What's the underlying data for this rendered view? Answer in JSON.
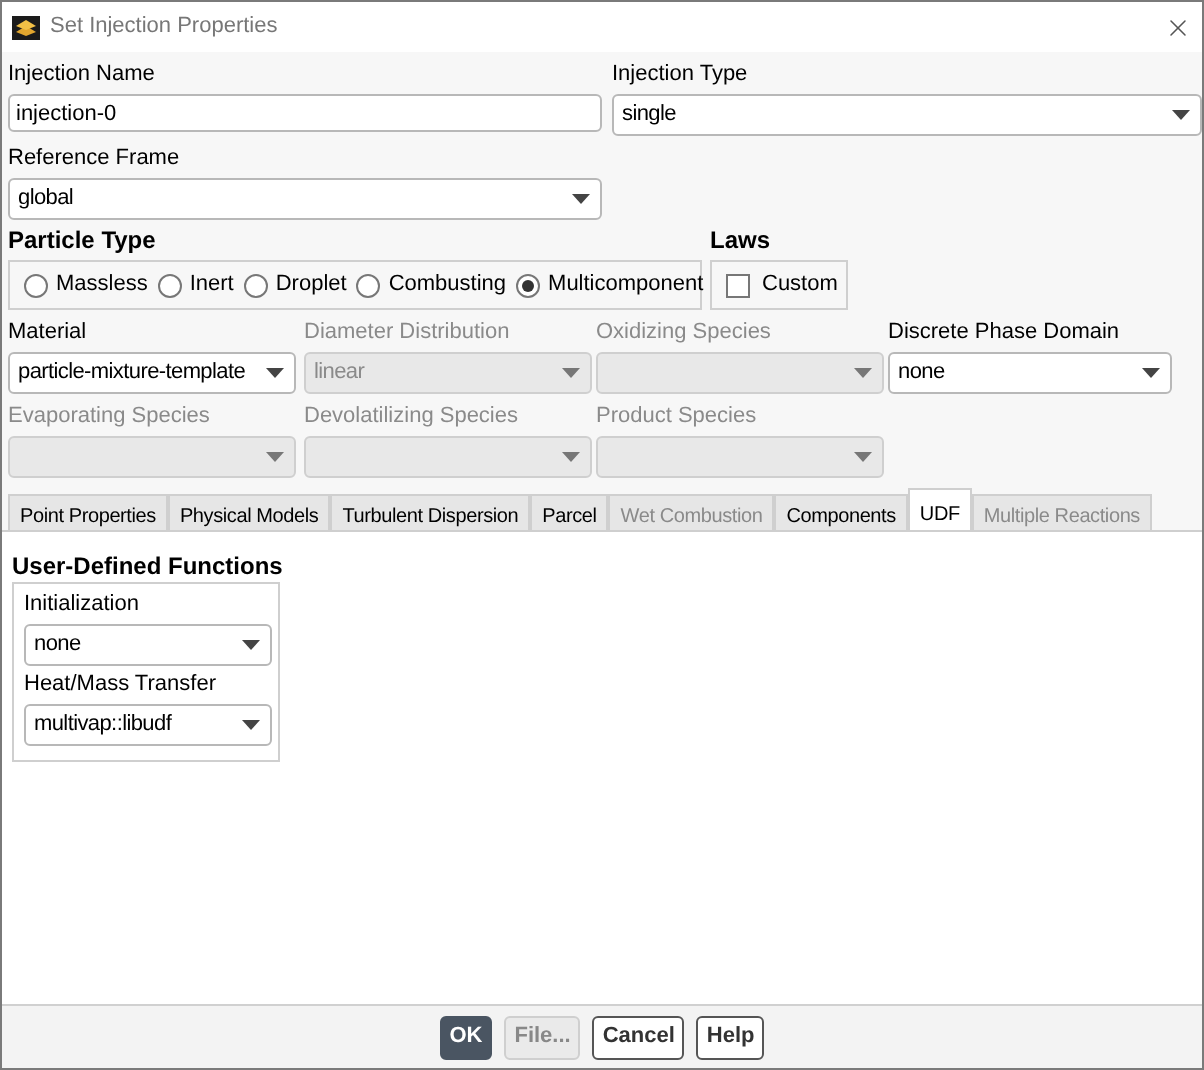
{
  "window": {
    "title": "Set Injection Properties"
  },
  "top_fields": [
    {
      "label": "Injection Name",
      "kind": "text",
      "value": "injection-0"
    },
    {
      "label": "Injection Type",
      "kind": "dropdown",
      "value": "single"
    },
    {
      "label": "Reference Frame",
      "kind": "dropdown",
      "value": "global"
    }
  ],
  "particle_type": {
    "label": "Particle Type",
    "options": [
      {
        "label": "Massless",
        "selected": false
      },
      {
        "label": "Inert",
        "selected": false
      },
      {
        "label": "Droplet",
        "selected": false
      },
      {
        "label": "Combusting",
        "selected": false
      },
      {
        "label": "Multicomponent",
        "selected": true
      }
    ]
  },
  "laws": {
    "label": "Laws",
    "options": [
      {
        "label": "Custom",
        "checked": false
      }
    ]
  },
  "species_fields": [
    {
      "label": "Material",
      "value": "particle-mixture-template",
      "disabled": false
    },
    {
      "label": "Diameter Distribution",
      "value": "linear",
      "disabled": true
    },
    {
      "label": "Oxidizing Species",
      "disabled": true
    },
    {
      "label": "Discrete Phase Domain",
      "value": "none",
      "disabled": false
    },
    {
      "label": "Evaporating Species",
      "disabled": true
    },
    {
      "label": "Devolatilizing Species",
      "disabled": true
    },
    {
      "label": "Product Species",
      "disabled": true
    }
  ],
  "tabs": [
    {
      "label": "Point Properties",
      "selected": false,
      "disabled": false
    },
    {
      "label": "Physical Models",
      "selected": false,
      "disabled": false
    },
    {
      "label": "Turbulent Dispersion",
      "selected": false,
      "disabled": false
    },
    {
      "label": "Parcel",
      "selected": false,
      "disabled": false
    },
    {
      "label": "Wet Combustion",
      "selected": false,
      "disabled": true
    },
    {
      "label": "Components",
      "selected": false,
      "disabled": false
    },
    {
      "label": "UDF",
      "selected": true,
      "disabled": false
    },
    {
      "label": "Multiple Reactions",
      "selected": false,
      "disabled": true
    }
  ],
  "udf": {
    "title": "User-Defined Functions",
    "fields": [
      {
        "label": "Initialization",
        "value": "none"
      },
      {
        "label": "Heat/Mass Transfer",
        "value": "multivap::libudf"
      }
    ]
  },
  "buttons": [
    {
      "label": "OK",
      "kind": "primary"
    },
    {
      "label": "File...",
      "kind": "disabled"
    },
    {
      "label": "Cancel",
      "kind": "normal"
    },
    {
      "label": "Help",
      "kind": "normal"
    }
  ]
}
